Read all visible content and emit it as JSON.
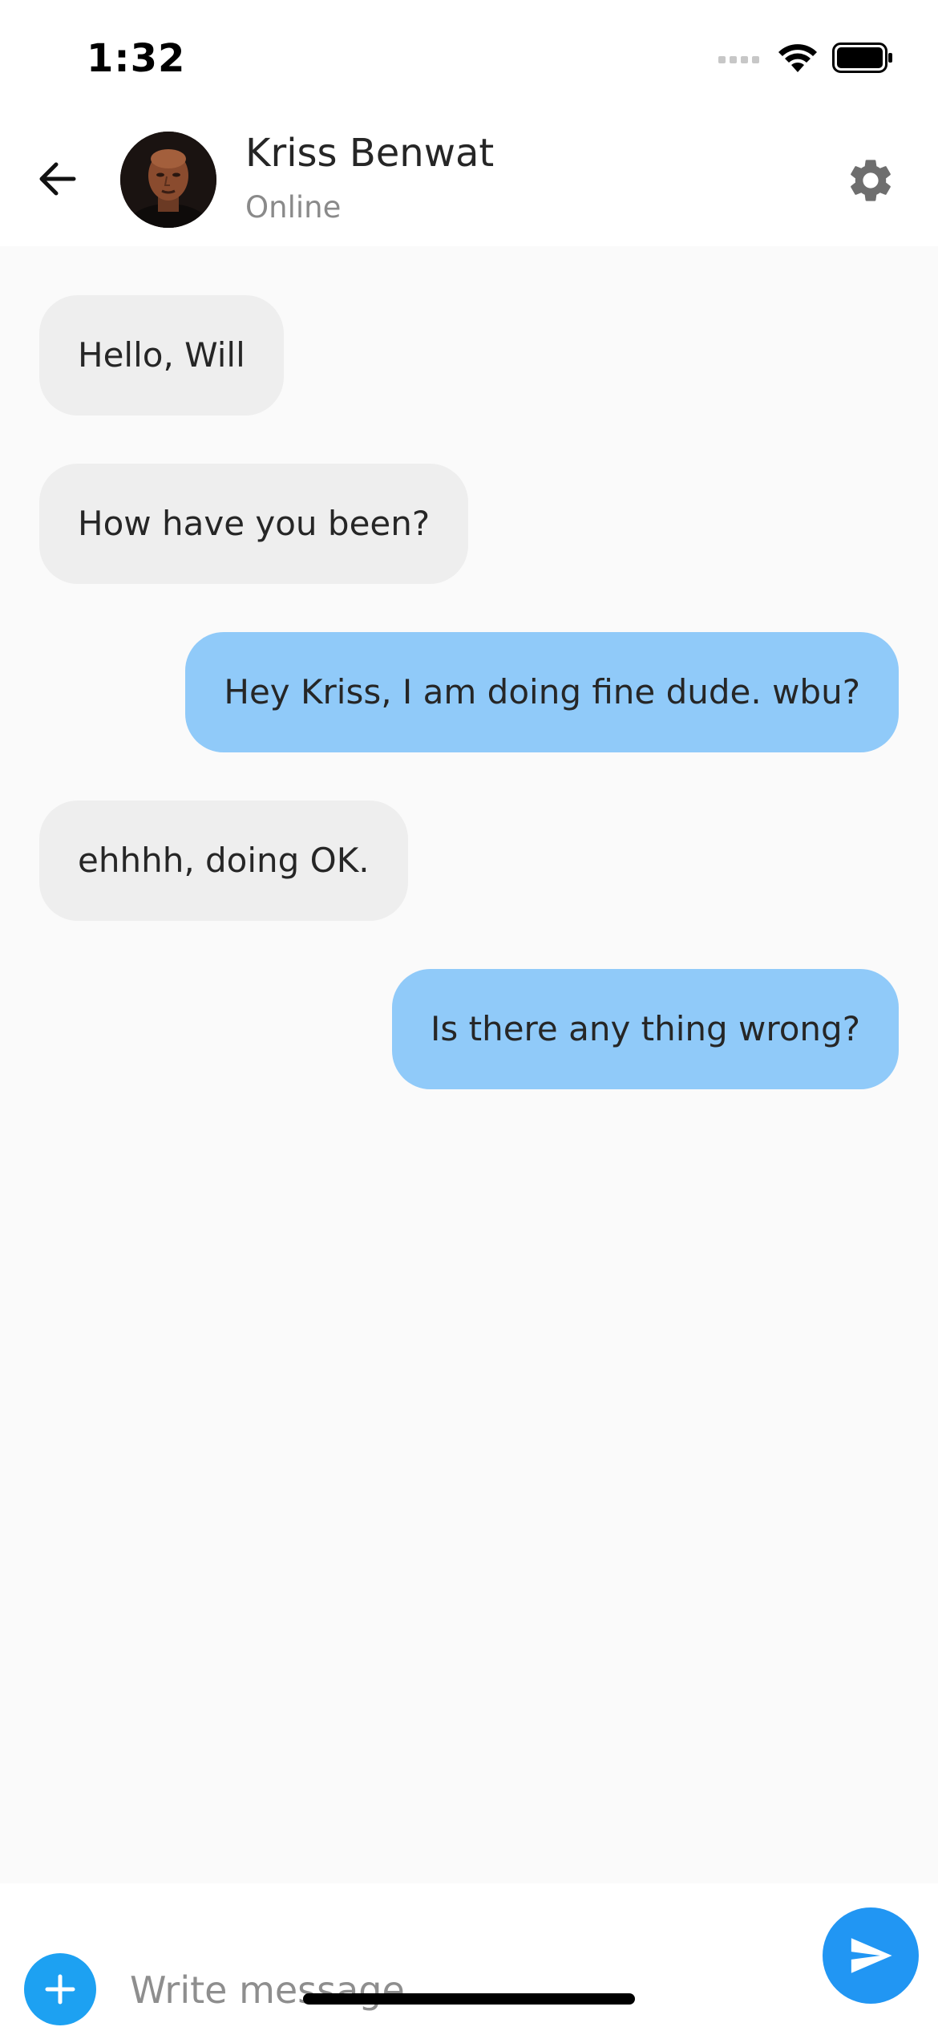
{
  "status_bar": {
    "time": "1:32",
    "icons": [
      "signal-icon",
      "wifi-icon",
      "battery-icon"
    ]
  },
  "header": {
    "contact_name": "Kriss Benwat",
    "contact_status": "Online",
    "icons": {
      "back": "arrow-back-icon",
      "settings": "gear-icon"
    }
  },
  "messages": [
    {
      "direction": "incoming",
      "text": "Hello, Will"
    },
    {
      "direction": "incoming",
      "text": "How have you been?"
    },
    {
      "direction": "outgoing",
      "text": "Hey Kriss, I am doing fine dude. wbu?"
    },
    {
      "direction": "incoming",
      "text": "ehhhh, doing OK."
    },
    {
      "direction": "outgoing",
      "text": "Is there any thing wrong?"
    }
  ],
  "composer": {
    "placeholder": "Write message...",
    "value": "",
    "icons": {
      "add": "plus-icon",
      "send": "send-icon"
    }
  },
  "colors": {
    "incoming_bubble": "#eeeeee",
    "outgoing_bubble": "#90caf9",
    "add_button": "#1da1f2",
    "send_button": "#2196f3",
    "background": "#fafafa"
  }
}
